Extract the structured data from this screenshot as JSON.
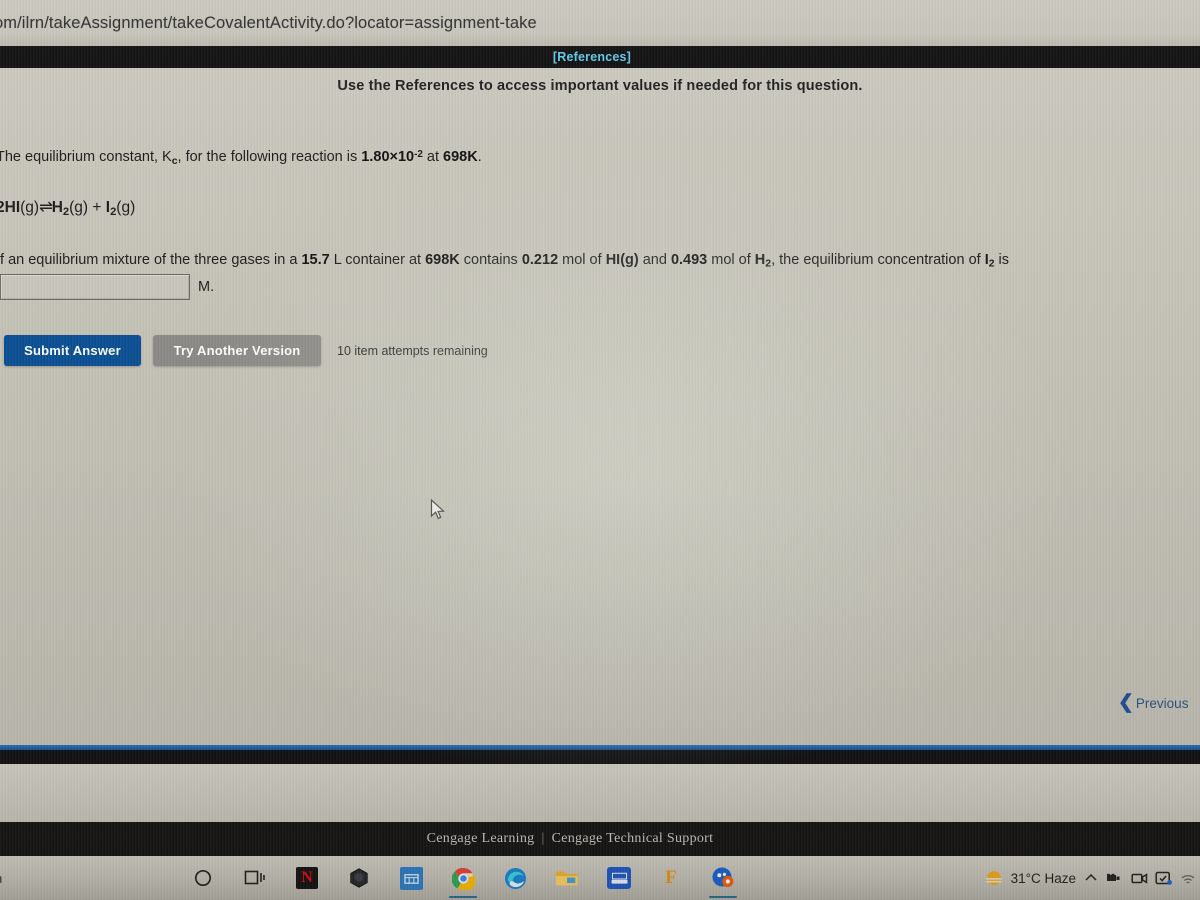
{
  "browser": {
    "url": "om/ilrn/takeAssignment/takeCovalentActivity.do?locator=assignment-take"
  },
  "references_bar": {
    "link_label": "[References]",
    "link_color": "#5ec8e8"
  },
  "question": {
    "instruction": "Use the References to access important values if needed for this question.",
    "line1": {
      "prefix": "The equilibrium constant, K",
      "subscript": "c",
      "middle": ", for the following reaction is ",
      "kc_value": "1.80×10",
      "kc_exponent": "-2",
      "suffix": " at ",
      "temperature": "698K",
      "period": "."
    },
    "equation": {
      "reactant_coeff": "2",
      "reactant": "HI",
      "reactant_state": "(g)",
      "arrow": "⇌",
      "product1": "H",
      "product1_sub": "2",
      "product1_state": "(g)",
      "plus": " + ",
      "product2": "I",
      "product2_sub": "2",
      "product2_state": "(g)"
    },
    "line3": {
      "p1": "If an equilibrium mixture of the three gases in a ",
      "volume": "15.7",
      "p2": " L container at ",
      "temperature": "698K",
      "p3": " contains ",
      "mol_hi": "0.212",
      "p4": " mol of ",
      "species_hi": "HI(g)",
      "p5": " and ",
      "mol_h2": "0.493",
      "p6": " mol of ",
      "species_h2": "H",
      "species_h2_sub": "2",
      "p7": ", the equilibrium concentration of ",
      "species_i2": "I",
      "species_i2_sub": "2",
      "p8": " is"
    },
    "answer_input_value": "",
    "answer_input_placeholder": "",
    "unit_label": "M."
  },
  "actions": {
    "submit_label": "Submit Answer",
    "submit_color": "#0a4f93",
    "retry_label": "Try Another Version",
    "retry_color": "#8c8a86",
    "attempts_text": "10 item attempts remaining"
  },
  "navigation": {
    "previous_label": "Previous",
    "previous_icon": "chevron-left-icon",
    "link_color": "#28527f"
  },
  "footer": {
    "brand": "Cengage Learning",
    "separator": "|",
    "support": "Cengage Technical Support"
  },
  "taskbar": {
    "left_text": "h",
    "icons": [
      {
        "name": "search-icon",
        "glyph": "◯",
        "label": "Search"
      },
      {
        "name": "task-view-icon",
        "glyph": "❑",
        "label": "Task View"
      },
      {
        "name": "netflix-icon",
        "glyph": "N",
        "label": "Netflix"
      },
      {
        "name": "hexagon-app-icon",
        "glyph": "⬢",
        "label": "Unity"
      },
      {
        "name": "blue-app-icon",
        "glyph": "▥",
        "label": "App"
      },
      {
        "name": "chrome-icon",
        "glyph": "",
        "label": "Google Chrome"
      },
      {
        "name": "edge-icon",
        "glyph": "",
        "label": "Microsoft Edge"
      },
      {
        "name": "file-explorer-icon",
        "glyph": "",
        "label": "File Explorer"
      },
      {
        "name": "office-app-icon",
        "glyph": "",
        "label": "Office"
      },
      {
        "name": "f-app-icon",
        "glyph": "F",
        "label": "F App"
      },
      {
        "name": "browser-app-icon",
        "glyph": "",
        "label": "Browser"
      }
    ],
    "tray": {
      "weather_icon": "sun-haze-icon",
      "weather_text": "31°C  Haze",
      "overflow_icon": "chevron-up-icon",
      "items": [
        {
          "name": "network-icon"
        },
        {
          "name": "camera-icon"
        },
        {
          "name": "onedrive-sync-icon"
        },
        {
          "name": "wifi-icon"
        }
      ]
    }
  }
}
